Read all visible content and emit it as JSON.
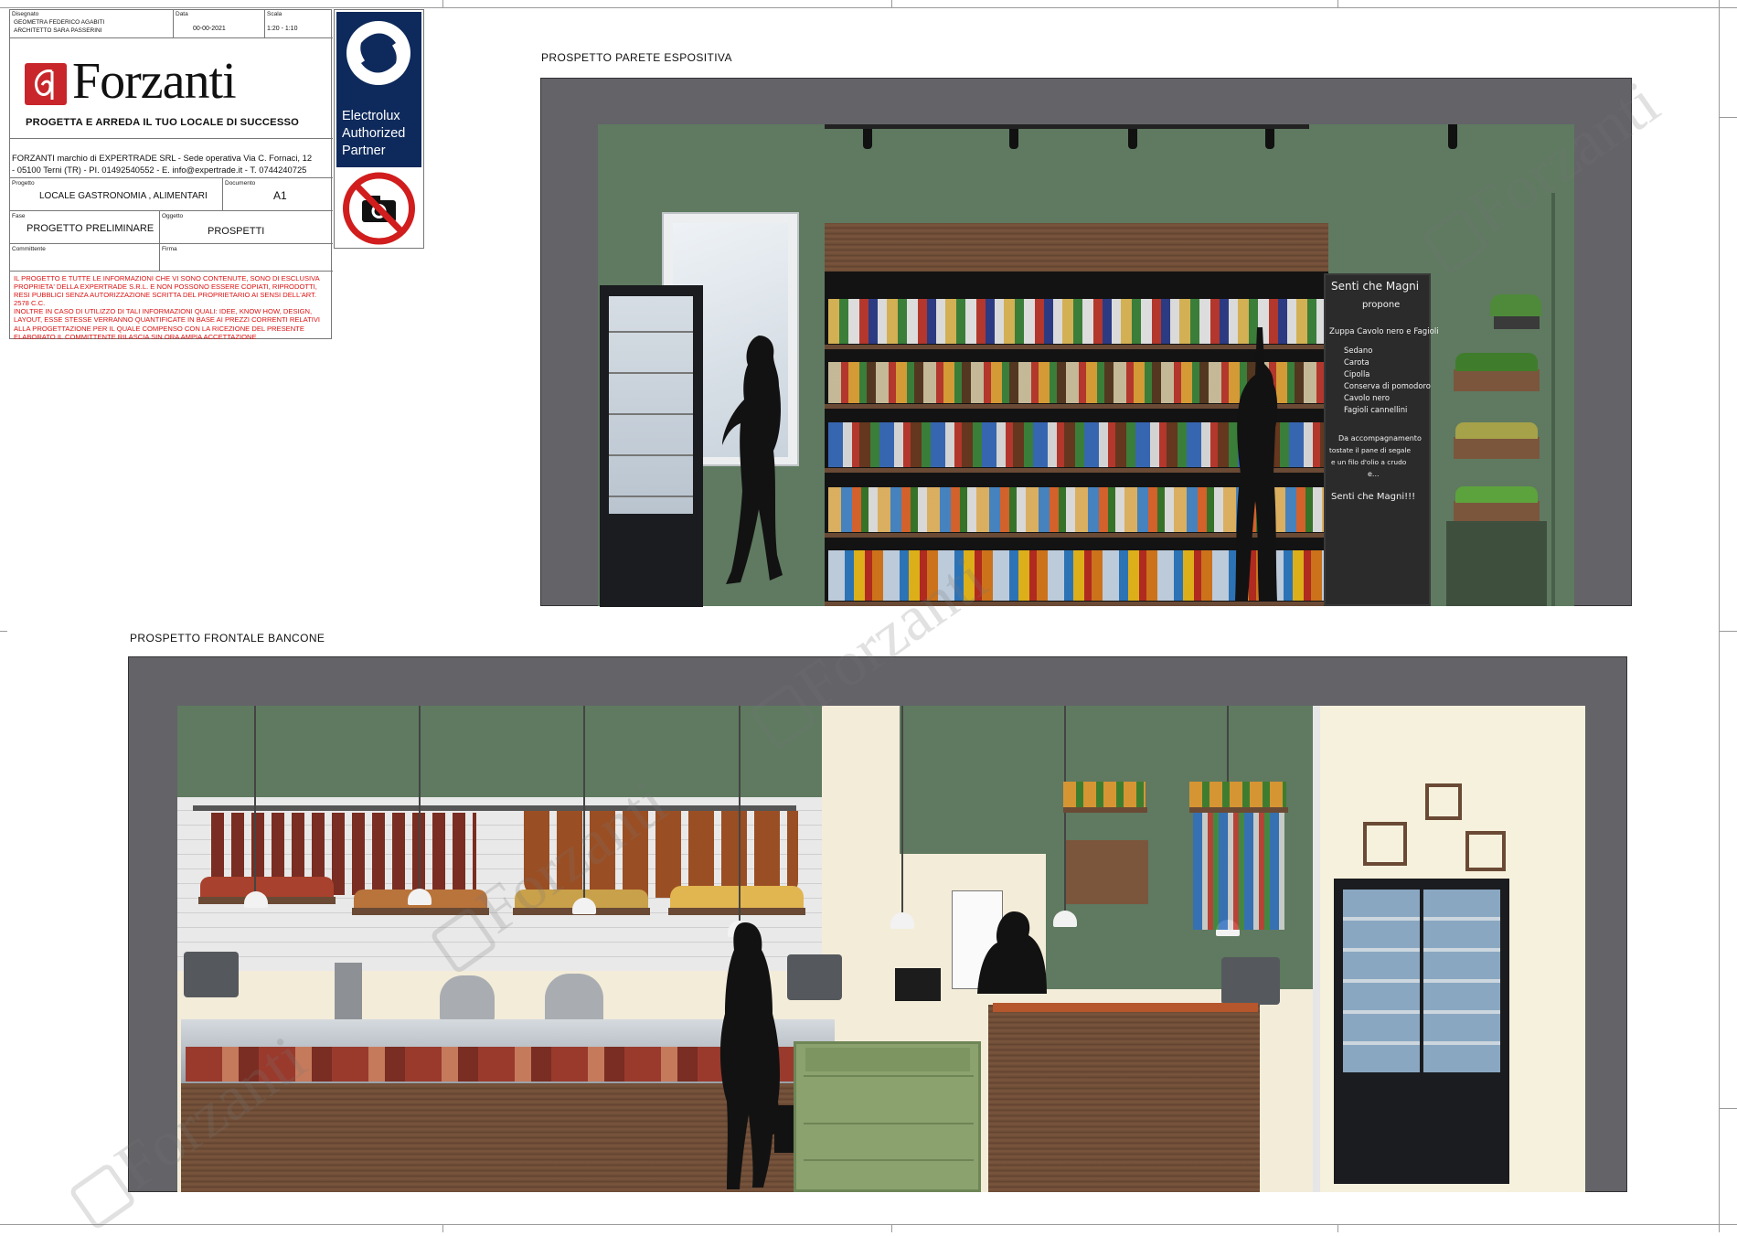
{
  "title_block": {
    "labels": {
      "drawn": "Disegnato",
      "date": "Data",
      "scale": "Scala",
      "project": "Progetto",
      "document": "Documento",
      "phase": "Fase",
      "object": "Oggetto",
      "client": "Committente",
      "signature": "Firma"
    },
    "drawn_by_1": "GEOMETRA FEDERICO AGABITI",
    "drawn_by_2": "ARCHITETTO SARA PASSERINI",
    "date": "00-00-2021",
    "scale": "1:20 - 1:10",
    "logo_text": "Forzanti",
    "tagline": "PROGETTA E ARREDA IL TUO LOCALE DI SUCCESSO",
    "company_line_1": "FORZANTI marchio di EXPERTRADE SRL - Sede operativa Via C. Fornaci, 12",
    "company_line_2": "- 05100 Terni (TR) - PI. 01492540552 - E. info@expertrade.it - T. 0744240725",
    "project": "LOCALE GASTRONOMIA , ALIMENTARI",
    "document": "A1",
    "phase": "PROGETTO PRELIMINARE",
    "object": "PROSPETTI",
    "client": "",
    "signature": "",
    "partner_1": "Electrolux",
    "partner_2": "Authorized",
    "partner_3": "Partner",
    "disclaimer_lines": [
      "IL PROGETTO E TUTTE LE INFORMAZIONI CHE VI SONO CONTENUTE, SONO DI ESCLUSIVA",
      "PROPRIETA' DELLA EXPERTRADE S.R.L. E NON POSSONO ESSERE COPIATI, RIPRODOTTI,",
      "RESI PUBBLICI SENZA AUTORIZZAZIONE SCRITTA DEL PROPRIETARIO AI SENSI DELL'ART.",
      "2578 C.C.",
      "INOLTRE IN CASO DI UTILIZZO DI TALI INFORMAZIONI QUALI: IDEE, KNOW HOW, DESIGN,",
      "LAYOUT, ESSE STESSE VERRANNO QUANTIFICATE IN BASE AI PREZZI CORRENTI RELATIVI",
      "ALLA PROGETTAZIONE PER IL QUALE COMPENSO CON LA RICEZIONE DEL PRESENTE",
      "ELABORATO IL COMMITTENTE RILASCIA SIN ORA AMPIA ACCETTAZIONE"
    ]
  },
  "sections": {
    "wall_title": "PROSPETTO PARETE ESPOSITIVA",
    "counter_title": "PROSPETTO FRONTALE BANCONE"
  },
  "chalkboard": {
    "title": "Senti che Magni",
    "subtitle": "propone",
    "dish": "Zuppa Cavolo nero e Fagioli",
    "ingredients": [
      "Sedano",
      "Carota",
      "Cipolla",
      "Conserva di pomodoro",
      "Cavolo nero",
      "Fagioli cannellini"
    ],
    "note_lines": [
      "Da accompagnamento",
      "tostate il pane di segale",
      "e un filo d'olio a crudo",
      "e..."
    ],
    "closing": "Senti che Magni!!!"
  },
  "watermark_text": "Forzanti",
  "colors": {
    "wall_green": "#5f7a60",
    "frame_grey": "#636368",
    "wood": "#6a4a35",
    "shelf_black": "#131313",
    "logo_red": "#c8262b",
    "electrolux_blue": "#0e2a5c",
    "warning_red": "#d11d1d"
  }
}
